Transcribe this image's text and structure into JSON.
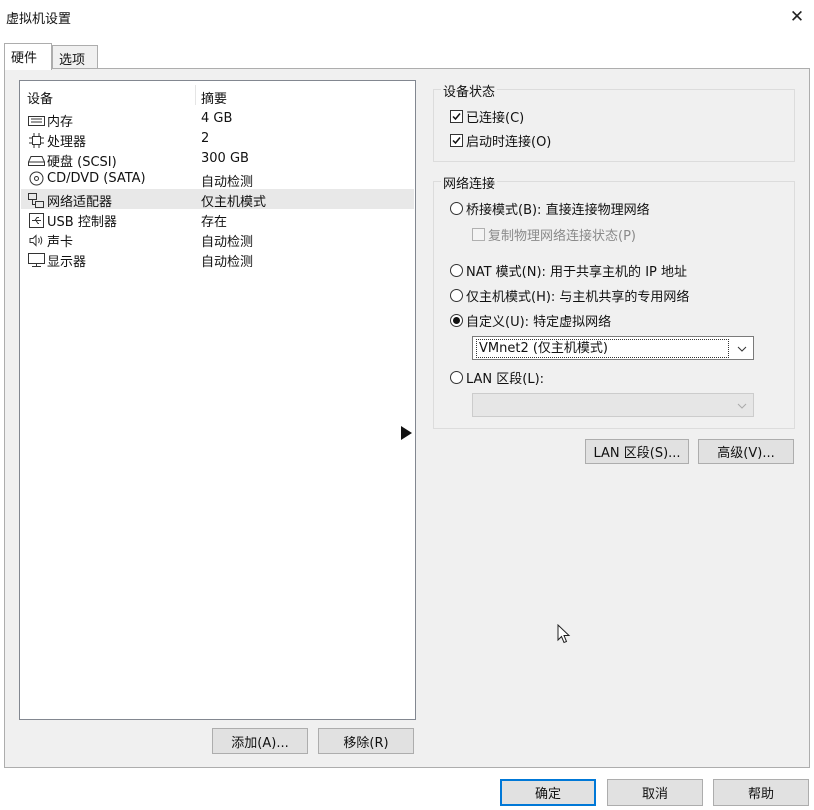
{
  "window": {
    "title": "虚拟机设置"
  },
  "tabs": [
    {
      "label": "硬件"
    },
    {
      "label": "选项"
    }
  ],
  "device_list": {
    "header_device": "设备",
    "header_summary": "摘要",
    "rows": [
      {
        "device": "内存",
        "summary": "4 GB",
        "icon": "memory-icon"
      },
      {
        "device": "处理器",
        "summary": "2",
        "icon": "processor-icon"
      },
      {
        "device": "硬盘 (SCSI)",
        "summary": "300 GB",
        "icon": "hard-disk-icon"
      },
      {
        "device": "CD/DVD (SATA)",
        "summary": "自动检测",
        "icon": "cd-dvd-icon"
      },
      {
        "device": "网络适配器",
        "summary": "仅主机模式",
        "icon": "network-adapter-icon",
        "selected": true
      },
      {
        "device": "USB 控制器",
        "summary": "存在",
        "icon": "usb-icon"
      },
      {
        "device": "声卡",
        "summary": "自动检测",
        "icon": "speaker-icon"
      },
      {
        "device": "显示器",
        "summary": "自动检测",
        "icon": "monitor-icon"
      }
    ]
  },
  "list_buttons": {
    "add": "添加(A)...",
    "remove": "移除(R)"
  },
  "device_status": {
    "title": "设备状态",
    "connected": {
      "label": "已连接(C)",
      "checked": true
    },
    "connect_at_power_on": {
      "label": "启动时连接(O)",
      "checked": true
    }
  },
  "network": {
    "title": "网络连接",
    "bridged": {
      "label": "桥接模式(B): 直接连接物理网络",
      "selected": false
    },
    "replicate": {
      "label": "复制物理网络连接状态(P)",
      "checked": false,
      "disabled": true
    },
    "nat": {
      "label": "NAT 模式(N): 用于共享主机的 IP 地址",
      "selected": false
    },
    "host_only": {
      "label": "仅主机模式(H): 与主机共享的专用网络",
      "selected": false
    },
    "custom": {
      "label": "自定义(U): 特定虚拟网络",
      "selected": true
    },
    "custom_select_value": "VMnet2 (仅主机模式)",
    "lan_segment": {
      "label": "LAN 区段(L):",
      "selected": false
    },
    "lan_select_value": ""
  },
  "panel_buttons": {
    "lan_segments": "LAN 区段(S)...",
    "advanced": "高级(V)..."
  },
  "footer_buttons": {
    "ok": "确定",
    "cancel": "取消",
    "help": "帮助"
  },
  "colors": {
    "panel_bg": "#f0f0f0",
    "button_bg": "#e1e1e1",
    "default_button_border": "#0078d7",
    "selected_row": "#e8e8e8"
  }
}
